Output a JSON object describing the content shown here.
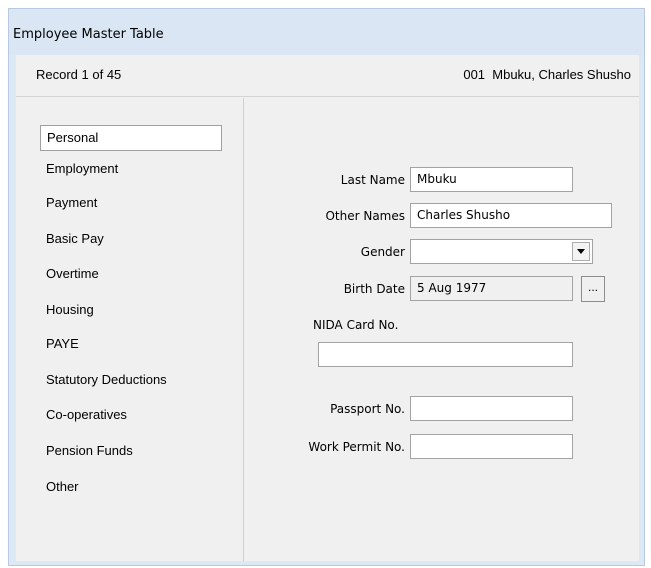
{
  "window": {
    "title": "Employee Master Table"
  },
  "record": {
    "count": "Record 1 of 45",
    "name": "001  Mbuku, Charles Shusho"
  },
  "nav": {
    "items": [
      {
        "label": "Personal",
        "selected": true
      },
      {
        "label": "Employment"
      },
      {
        "label": "Payment"
      },
      {
        "label": "Basic Pay"
      },
      {
        "label": "Overtime"
      },
      {
        "label": "Housing"
      },
      {
        "label": "PAYE"
      },
      {
        "label": "Statutory Deductions"
      },
      {
        "label": "Co-operatives"
      },
      {
        "label": "Pension Funds"
      },
      {
        "label": "Other"
      }
    ]
  },
  "form": {
    "last_name": {
      "label": "Last Name",
      "value": "Mbuku"
    },
    "other_names": {
      "label": "Other Names",
      "value": "Charles Shusho"
    },
    "gender": {
      "label": "Gender",
      "value": ""
    },
    "birth_date": {
      "label": "Birth Date",
      "value": "5 Aug 1977",
      "button": "..."
    },
    "nida": {
      "label": "NIDA Card No.",
      "value": ""
    },
    "passport": {
      "label": "Passport No.",
      "value": ""
    },
    "work_permit": {
      "label": "Work Permit No.",
      "value": ""
    }
  }
}
